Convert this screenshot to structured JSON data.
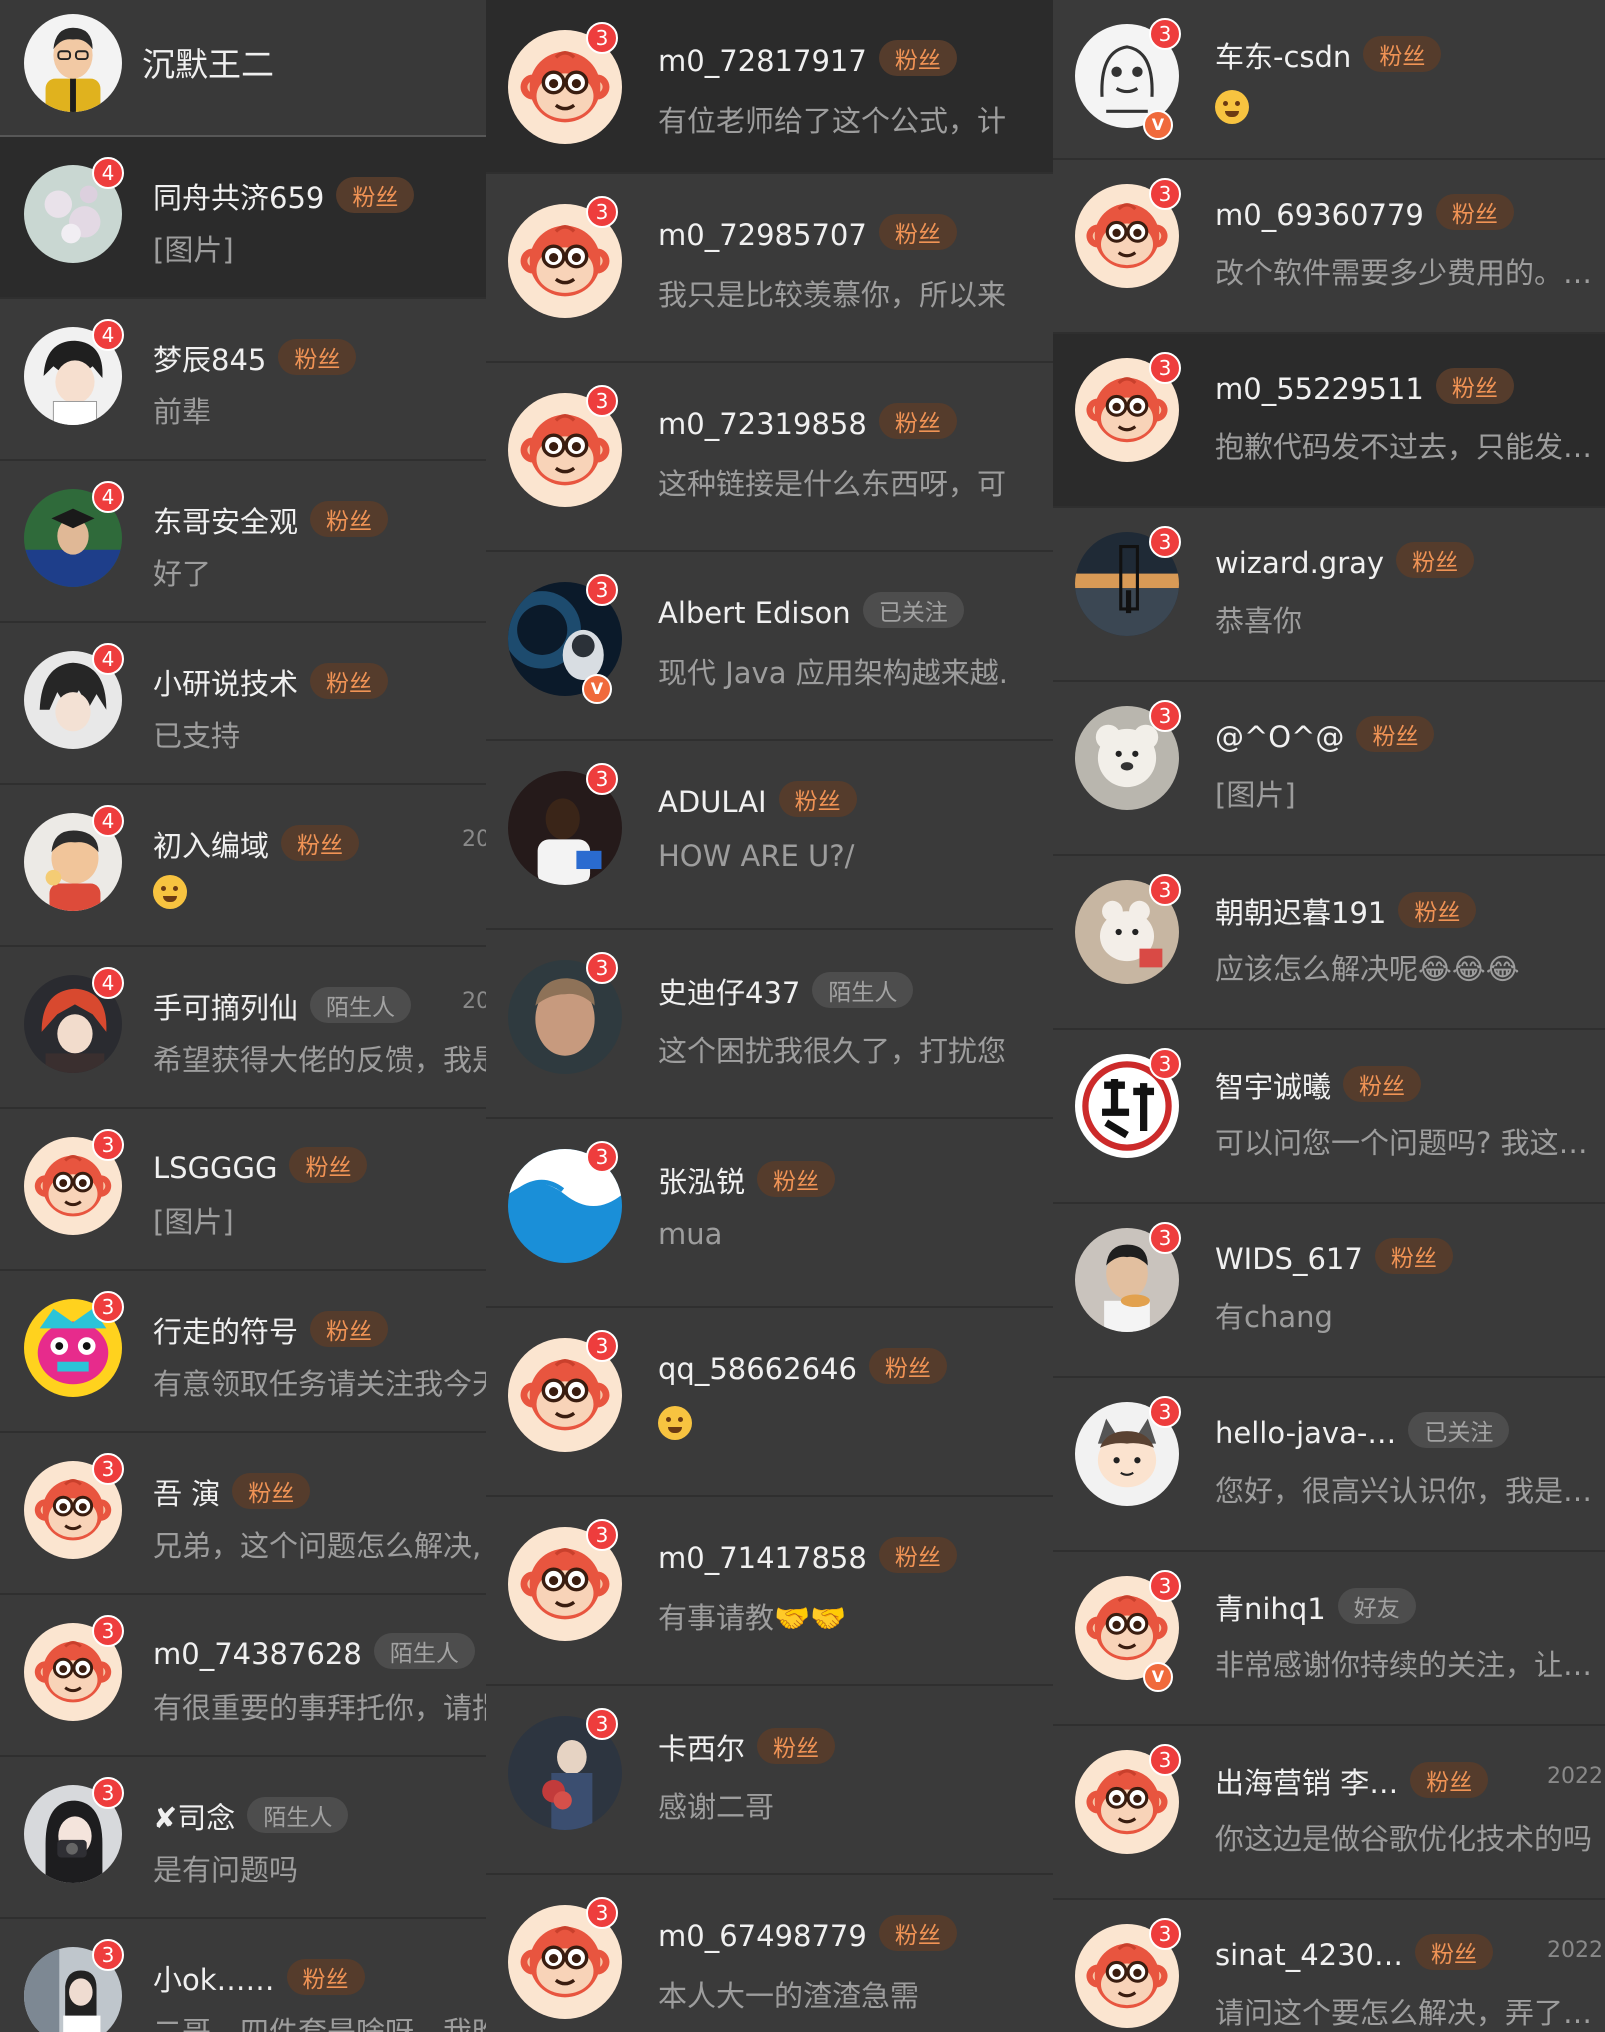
{
  "header": {
    "title": "沉默王二"
  },
  "columns": [
    {
      "rows": [
        {
          "name": "同舟共济659",
          "tag": "粉丝",
          "msg": "[图片]",
          "badge": "4",
          "avatar": "flower"
        },
        {
          "name": "梦辰845",
          "tag": "粉丝",
          "msg": "前辈",
          "badge": "4",
          "avatar": "anime-boy"
        },
        {
          "name": "东哥安全观",
          "tag": "粉丝",
          "msg": "好了",
          "badge": "4",
          "avatar": "graduate"
        },
        {
          "name": "小研说技术",
          "tag": "粉丝",
          "msg": "已支持",
          "badge": "4",
          "avatar": "anime-dark"
        },
        {
          "name": "初入编域",
          "tag": "粉丝",
          "msg": "",
          "emoji": "thinking-emoji",
          "badge": "4",
          "time": "20",
          "avatar": "cartoon-thumbs"
        },
        {
          "name": "手可摘列仙",
          "tag": "陌生人",
          "msg": "希望获得大佬的反馈，我是",
          "badge": "4",
          "time": "20",
          "avatar": "anime-red"
        },
        {
          "name": "LSGGGG",
          "tag": "粉丝",
          "msg": "[图片]",
          "badge": "3",
          "avatar": "monkey"
        },
        {
          "name": "行走的符号",
          "tag": "粉丝",
          "msg": "有意领取任务请关注我今天",
          "badge": "3",
          "avatar": "colorful-mask"
        },
        {
          "name": "吾 演",
          "tag": "粉丝",
          "msg": "兄弟，这个问题怎么解决,",
          "badge": "3",
          "avatar": "monkey"
        },
        {
          "name": "m0_74387628",
          "tag": "陌生人",
          "msg": "有很重要的事拜托你，请指",
          "badge": "3",
          "avatar": "monkey"
        },
        {
          "name": "✘司念",
          "tag": "陌生人",
          "msg": "是有问题吗",
          "badge": "3",
          "avatar": "girl-camera"
        },
        {
          "name": "小ok……",
          "tag": "粉丝",
          "msg": "二哥，四件套是啥呀，我昨",
          "badge": "3",
          "avatar": "girl-room"
        }
      ]
    },
    {
      "rows": [
        {
          "name": "m0_72817917",
          "tag": "粉丝",
          "msg": "有位老师给了这个公式，计",
          "badge": "3",
          "avatar": "monkey"
        },
        {
          "name": "m0_72985707",
          "tag": "粉丝",
          "msg": "我只是比较羡慕你，所以来",
          "badge": "3",
          "avatar": "monkey"
        },
        {
          "name": "m0_72319858",
          "tag": "粉丝",
          "msg": "这种链接是什么东西呀，可",
          "badge": "3",
          "avatar": "monkey"
        },
        {
          "name": "Albert Edison",
          "tag": "已关注",
          "msg": "现代 Java 应用架构越来越.",
          "badge": "3",
          "verified": "V",
          "avatar": "space"
        },
        {
          "name": "ADULAI",
          "tag": "粉丝",
          "msg": "HOW ARE U?/",
          "badge": "3",
          "avatar": "man-dark"
        },
        {
          "name": "史迪仔437",
          "tag": "陌生人",
          "msg": "这个困扰我很久了，打扰您",
          "badge": "3",
          "avatar": "blur-face"
        },
        {
          "name": "张泓锐",
          "tag": "粉丝",
          "msg": "mua",
          "badge": "3",
          "avatar": "wave"
        },
        {
          "name": "qq_58662646",
          "tag": "粉丝",
          "msg": "",
          "emoji": "blush-emoji",
          "badge": "3",
          "avatar": "monkey"
        },
        {
          "name": "m0_71417858",
          "tag": "粉丝",
          "msg": "有事请教🤝🤝",
          "badge": "3",
          "avatar": "monkey"
        },
        {
          "name": "卡西尔",
          "tag": "粉丝",
          "msg": "感谢二哥",
          "badge": "3",
          "avatar": "flowers-dark"
        },
        {
          "name": "m0_67498779",
          "tag": "粉丝",
          "msg": "本人大一的渣渣急需",
          "badge": "3",
          "avatar": "monkey"
        }
      ]
    },
    {
      "rows": [
        {
          "name": "车东-csdn",
          "tag": "粉丝",
          "msg": "",
          "emoji": "yum-emoji",
          "badge": "3",
          "verified": "V",
          "avatar": "sketch"
        },
        {
          "name": "m0_69360779",
          "tag": "粉丝",
          "msg": "改个软件需要多少费用的。…",
          "badge": "3",
          "avatar": "monkey"
        },
        {
          "name": "m0_55229511",
          "tag": "粉丝",
          "msg": "抱歉代码发不过去，只能发…",
          "badge": "3",
          "avatar": "monkey"
        },
        {
          "name": "wizard.gray",
          "tag": "粉丝",
          "msg": "恭喜你",
          "badge": "3",
          "avatar": "sunset"
        },
        {
          "name": "@^O^@",
          "tag": "粉丝",
          "msg": "[图片]",
          "badge": "3",
          "avatar": "teddy"
        },
        {
          "name": "朝朝迟暮191",
          "tag": "粉丝",
          "msg": "应该怎么解决呢😂😂😂",
          "badge": "3",
          "avatar": "toy"
        },
        {
          "name": "智宇诚曦",
          "tag": "粉丝",
          "msg": "可以问您一个问题吗? 我这…",
          "badge": "3",
          "avatar": "calligraphy"
        },
        {
          "name": "WIDS_617",
          "tag": "粉丝",
          "msg": "有chang",
          "badge": "3",
          "avatar": "man-eating"
        },
        {
          "name": "hello-java-…",
          "tag": "已关注",
          "msg": "您好，很高兴认识你，我是…",
          "badge": "3",
          "avatar": "cartoon-cat"
        },
        {
          "name": "青nihq1",
          "tag": "好友",
          "msg": "非常感谢你持续的关注，让…",
          "badge": "3",
          "verified": "V",
          "avatar": "monkey"
        },
        {
          "name": "出海营销 李…",
          "tag": "粉丝",
          "msg": "你这边是做谷歌优化技术的吗",
          "badge": "3",
          "time": "2022",
          "avatar": "monkey"
        },
        {
          "name": "sinat_4230…",
          "tag": "粉丝",
          "msg": "请问这个要怎么解决，弄了…",
          "badge": "3",
          "time": "2022",
          "avatar": "monkey"
        }
      ]
    }
  ]
}
